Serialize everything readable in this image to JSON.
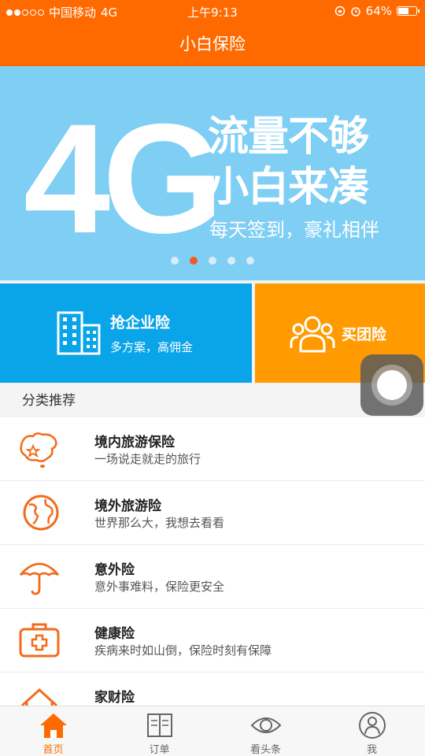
{
  "status_bar": {
    "carrier": "中国移动",
    "network": "4G",
    "time": "上午9:13",
    "battery": "64%",
    "battery_level": 0.64
  },
  "nav": {
    "title": "小白保险"
  },
  "banner": {
    "big_text": "4G",
    "line1": "流量不够",
    "line2": "小白来凑",
    "line3": "每天签到，豪礼相伴",
    "page_count": 5,
    "active_page": 2
  },
  "tiles": {
    "enterprise": {
      "title": "抢企业险",
      "subtitle": "多方案，高佣金"
    },
    "group": {
      "title": "买团险"
    }
  },
  "section": {
    "title": "分类推荐"
  },
  "categories": [
    {
      "icon": "china-map-icon",
      "title": "境内旅游保险",
      "subtitle": "一场说走就走的旅行"
    },
    {
      "icon": "globe-icon",
      "title": "境外旅游险",
      "subtitle": "世界那么大，我想去看看"
    },
    {
      "icon": "umbrella-icon",
      "title": "意外险",
      "subtitle": "意外事难料，保险更安全"
    },
    {
      "icon": "medical-kit-icon",
      "title": "健康险",
      "subtitle": "疾病来时如山倒，保险时刻有保障"
    },
    {
      "icon": "house-icon",
      "title": "家财险",
      "subtitle": ""
    }
  ],
  "tabbar": [
    {
      "icon": "home-icon",
      "label": "首页",
      "active": true
    },
    {
      "icon": "order-book-icon",
      "label": "订单",
      "active": false
    },
    {
      "icon": "eye-icon",
      "label": "看头条",
      "active": false
    },
    {
      "icon": "user-icon",
      "label": "我",
      "active": false
    }
  ],
  "colors": {
    "brand": "#ff6a00",
    "banner_bg": "#7fcef4",
    "tile_blue": "#0aa4e8",
    "tile_orange": "#ff9a00"
  }
}
